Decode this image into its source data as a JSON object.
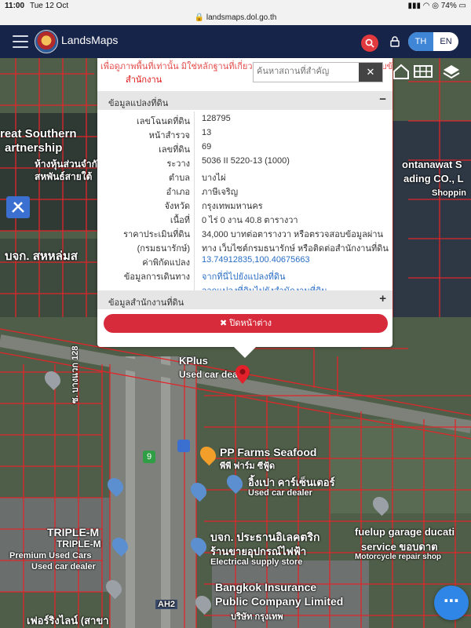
{
  "status_bar": {
    "time": "11:00",
    "date": "Tue 12 Oct",
    "battery": "74%"
  },
  "url": "landsmaps.dol.go.th",
  "app": {
    "title": "LandsMaps",
    "lang_th": "TH",
    "lang_en": "EN"
  },
  "popup": {
    "notice_line1": "เพื่อดูภาพพื้นที่เท่านั้น มิใช่หลักฐานที่เกี่ยวข้องกับทางกฎหมาย กรุณาตรวจสอบข้อมูล",
    "notice_line2": "สำนักงาน",
    "search_placeholder": "ค้นหาสถานที่สำคัญ",
    "section1_title": "ข้อมูลแปลงที่ดิน",
    "section1_toggle": "−",
    "section2_title": "ข้อมูลสำนักงานที่ดิน",
    "section2_toggle": "+",
    "close_label": "✖ ปิดหน้าต่าง",
    "rows": [
      {
        "label": "เลขโฉนดที่ดิน",
        "value": "128795"
      },
      {
        "label": "หน้าสำรวจ",
        "value": "13"
      },
      {
        "label": "เลขที่ดิน",
        "value": "69"
      },
      {
        "label": "ระวาง",
        "value": "5036 II 5220-13 (1000)"
      },
      {
        "label": "ตำบล",
        "value": "บางไผ่"
      },
      {
        "label": "อำเภอ",
        "value": "ภาษีเจริญ"
      },
      {
        "label": "จังหวัด",
        "value": "กรุงเทพมหานคร"
      },
      {
        "label": "เนื้อที่",
        "value": "0 ไร่ 0 งาน 40.8 ตารางวา"
      },
      {
        "label": "ราคาประเมินที่ดิน",
        "value": "34,000 บาทต่อตารางวา หรือตรวจสอบข้อมูลผ่าน"
      },
      {
        "label": "(กรมธนารักษ์)",
        "value": "ทาง เว็บไซต์กรมธนารักษ์ หรือติดต่อสำนักงานที่ดิน"
      },
      {
        "label": "ค่าพิกัดแปลง",
        "value": "13.74912835,100.40675663"
      },
      {
        "label": "ข้อมูลการเดินทาง",
        "value": "จากที่นี่ไปยังแปลงที่ดิน"
      },
      {
        "label": "",
        "value": "จากแปลงที่ดินไปยังสำนักงานที่ดิน"
      }
    ]
  },
  "map_labels": {
    "l1": "reat Southern",
    "l2": "artnership",
    "l3": "ห้างหุ้นส่วนจำกัด",
    "l4": "สหพันธ์สายใต้",
    "l5": "ontanawat S",
    "l6": "ading CO., L",
    "l7": "Shoppin",
    "l8": "บจก. สหหล่มส",
    "l9": "KPlus",
    "l10": "Used car dealer",
    "l11": "ซ. บางแวก 128",
    "l12": "PP Farms Seafood",
    "l13": "พีพี ฟาร์ม ซีฟู้ด",
    "l14": "อิ้งเปา คาร์เซ็นเตอร์",
    "l15": "Used car dealer",
    "l16": "TRIPLE-M",
    "l17": "TRIPLE-M",
    "l18": "Premium Used Cars",
    "l19": "Used car dealer",
    "l20": "บจก. ประธานอิเลคตริก",
    "l21": "ร้านขายอุปกรณ์ไฟฟ้า",
    "l22": "Electrical supply store",
    "l23": "fuelup garage ducati",
    "l24": "service ขอบดาต",
    "l25": "Motorcycle repair shop",
    "l26": "Bangkok Insurance",
    "l27": "Public Company Limited",
    "l28": "บริษัท กรุงเทพ",
    "l29": "เฟอร์ริงไลน์ (สาขา",
    "l30": "AH2",
    "l31": "9",
    "l32": "Used car dealer"
  },
  "fab_label": "⋯"
}
